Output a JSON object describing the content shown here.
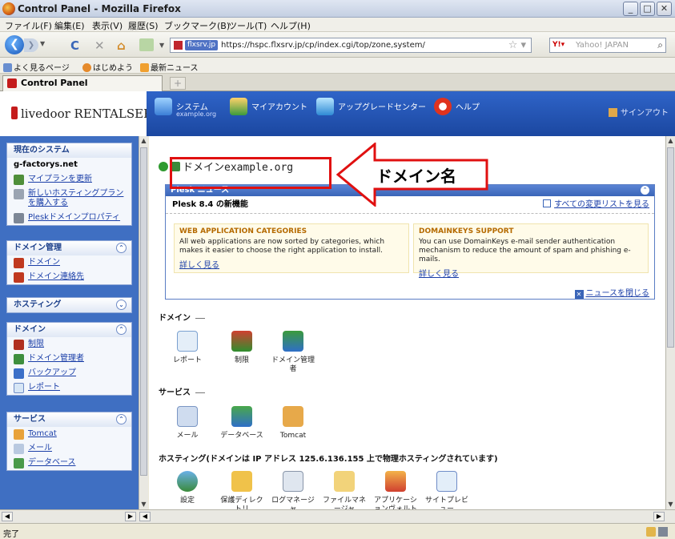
{
  "window": {
    "title": "Control Panel - Mozilla Firefox"
  },
  "menu": [
    "ファイル(F)",
    "編集(E)",
    "表示(V)",
    "履歴(S)",
    "ブックマーク(B)",
    "ツール(T)",
    "ヘルプ(H)"
  ],
  "nav": {
    "site_badge": "flxsrv.jp",
    "url": "https://hspc.flxsrv.jp/cp/index.cgi/top/zone,system/",
    "search_placeholder": "Yahoo! JAPAN"
  },
  "bookmarks": [
    "よく見るページ",
    "はじめよう",
    "最新ニュース"
  ],
  "tab": {
    "label": "Control Panel",
    "new_tab": "+"
  },
  "header": {
    "logo": "livedoor RENTALSERVER",
    "items": [
      {
        "label": "システム",
        "sub": "example.org"
      },
      {
        "label": "マイアカウント",
        "sub": ""
      },
      {
        "label": "アップグレードセンター",
        "sub": ""
      },
      {
        "label": "ヘルプ",
        "sub": ""
      }
    ],
    "signout": "サインアウト"
  },
  "sidebar": {
    "current": {
      "title": "現在のシステム",
      "host": "g-factorys.net",
      "items": [
        "マイプランを更新",
        "新しいホスティングプランを購入する",
        "Pleskドメインプロパティ"
      ]
    },
    "domain_mgmt": {
      "title": "ドメイン管理",
      "items": [
        "ドメイン",
        "ドメイン連絡先"
      ]
    },
    "hosting": {
      "title": "ホスティング"
    },
    "domain": {
      "title": "ドメイン",
      "items": [
        "制限",
        "ドメイン管理者",
        "バックアップ",
        "レポート"
      ]
    },
    "service": {
      "title": "サービス",
      "items": [
        "Tomcat",
        "メール",
        "データベース"
      ]
    }
  },
  "main": {
    "domain_title": "ドメインexample.org",
    "callout": "ドメイン名",
    "news": {
      "title": "Plesk ニュース",
      "subtitle": "Plesk 8.4 の新機能",
      "changes_link": "すべての変更リストを見る",
      "cards": [
        {
          "title": "WEB APPLICATION CATEGORIES",
          "body": "All web applications are now sorted by categories, which makes it easier to choose the right application to install.",
          "more": "詳しく見る"
        },
        {
          "title": "DOMAINKEYS SUPPORT",
          "body": "You can use DomainKeys e-mail sender authentication mechanism to reduce the amount of spam and phishing e-mails.",
          "more": "詳しく見る"
        }
      ],
      "close": "ニュースを閉じる"
    },
    "sections": {
      "domain": {
        "title": "ドメイン",
        "tools": [
          "レポート",
          "制限",
          "ドメイン管理者"
        ]
      },
      "services": {
        "title": "サービス",
        "tools": [
          "メール",
          "データベース",
          "Tomcat"
        ]
      },
      "hosting": {
        "title": "ホスティング(ドメインは IP アドレス 125.6.136.155 上で物理ホスティングされています)",
        "tools": [
          "設定",
          "保護ディレクトリ",
          "ログマネージャ",
          "ファイルマネージャ",
          "アプリケーションヴォルト",
          "サイトプレビュー"
        ]
      }
    }
  },
  "status": {
    "text": "完了"
  }
}
